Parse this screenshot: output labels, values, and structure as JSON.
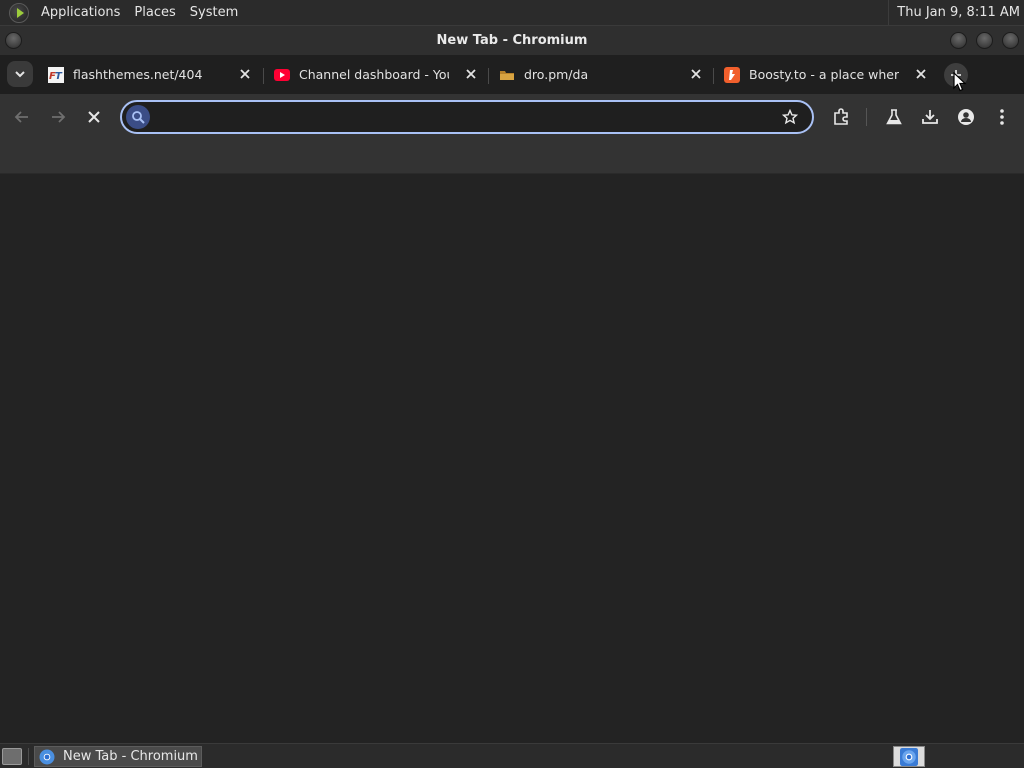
{
  "top_panel": {
    "menus": [
      "Applications",
      "Places",
      "System"
    ],
    "clock": "Thu Jan  9,  8:11 AM"
  },
  "window": {
    "title": "New Tab - Chromium"
  },
  "tabs": [
    {
      "label": "flashthemes.net/404",
      "favicon": "flashthemes-icon"
    },
    {
      "label": "Channel dashboard - YouTube Studio",
      "favicon": "youtube-icon"
    },
    {
      "label": "dro.pm/da",
      "favicon": "folder-icon"
    },
    {
      "label": "Boosty.to - a place where s",
      "favicon": "boosty-icon"
    }
  ],
  "omnibox": {
    "value": "",
    "placeholder": ""
  },
  "taskbar": {
    "items": [
      {
        "label": "New Tab - Chromium",
        "icon": "chromium-icon"
      }
    ]
  },
  "colors": {
    "accent": "#a9c1f5",
    "background": "#232323",
    "toolbar": "#333333"
  }
}
